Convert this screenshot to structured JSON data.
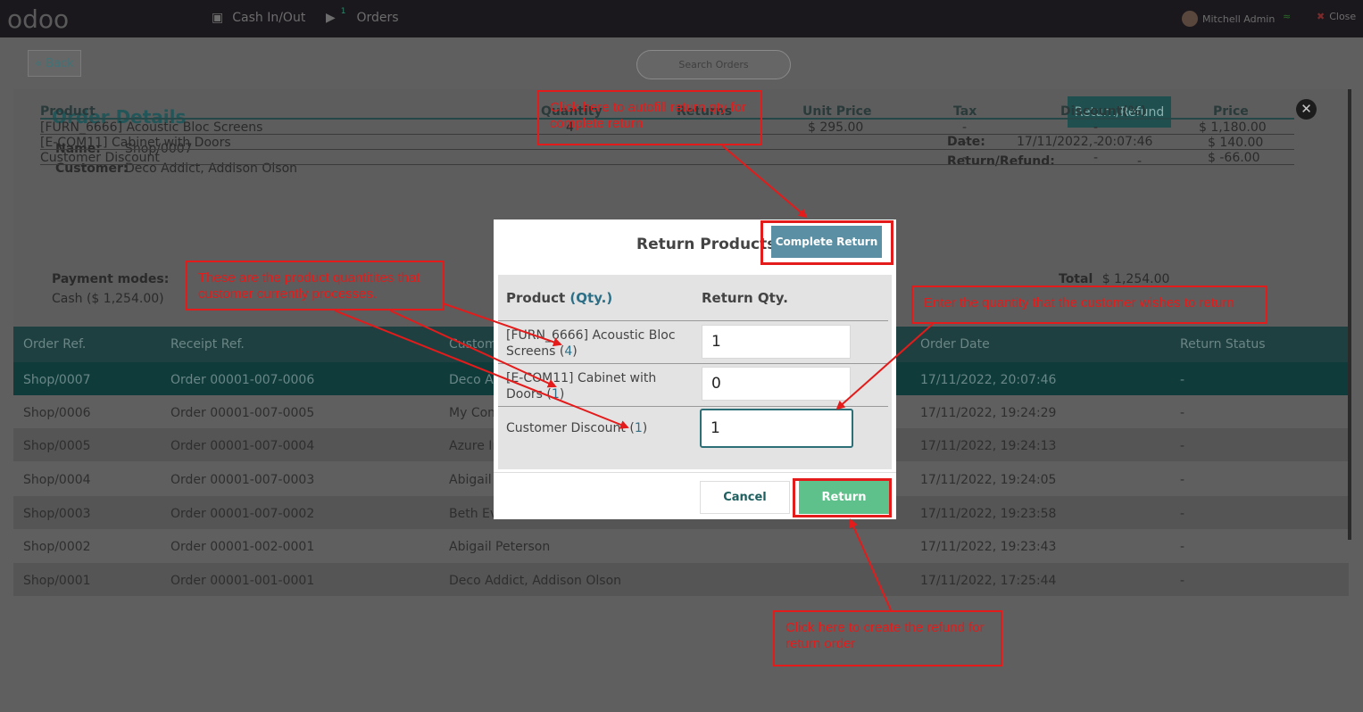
{
  "topbar": {
    "logo": "odoo",
    "cash_label": "Cash In/Out",
    "orders_label": "Orders",
    "orders_badge": "1",
    "user": "Mitchell Admin",
    "close_label": "Close"
  },
  "toolbar": {
    "back_label": "« Back",
    "search_placeholder": "Search Orders"
  },
  "details": {
    "title": "Order Details",
    "name_label": "Name:",
    "name_value": "Shop/0007",
    "customer_label": "Customer:",
    "customer_value": "Deco Addict, Addison Olson",
    "date_label": "Date:",
    "date_value": "17/11/2022, 20:07:46",
    "rr_label": "Return/Refund:",
    "rr_value": "-",
    "rr_button": "Return/Refund",
    "payment_label": "Payment modes:",
    "payment_value": "Cash ($ 1,254.00)",
    "total_label": "Total",
    "total_value": "$ 1,254.00",
    "headers": [
      "Product",
      "Quantity",
      "Returns",
      "Unit Price",
      "Tax",
      "Discount(%)",
      "Price"
    ],
    "rows": [
      {
        "product": "[FURN_6666] Acoustic Bloc Screens",
        "qty": "4",
        "unit": "$ 295.00",
        "tax": "-",
        "disc": "-",
        "price": "$ 1,180.00"
      },
      {
        "product": "[E-COM11] Cabinet with Doors",
        "qty": "",
        "unit": "",
        "tax": "-",
        "disc": "-",
        "price": "$ 140.00"
      },
      {
        "product": "Customer Discount",
        "qty": "",
        "unit": "",
        "tax": "-",
        "disc": "-",
        "price": "$ -66.00"
      }
    ]
  },
  "orders": {
    "headers": [
      "Order Ref.",
      "Receipt Ref.",
      "Custom",
      "Order Date",
      "Return Status"
    ],
    "rows": [
      {
        "ref": "Shop/0007",
        "receipt": "Order 00001-007-0006",
        "customer": "Deco A",
        "date": "17/11/2022, 20:07:46",
        "status": "-"
      },
      {
        "ref": "Shop/0006",
        "receipt": "Order 00001-007-0005",
        "customer": "My Com",
        "date": "17/11/2022, 19:24:29",
        "status": "-"
      },
      {
        "ref": "Shop/0005",
        "receipt": "Order 00001-007-0004",
        "customer": "Azure In",
        "date": "17/11/2022, 19:24:13",
        "status": "-"
      },
      {
        "ref": "Shop/0004",
        "receipt": "Order 00001-007-0003",
        "customer": "Abigail P",
        "date": "17/11/2022, 19:24:05",
        "status": "-"
      },
      {
        "ref": "Shop/0003",
        "receipt": "Order 00001-007-0002",
        "customer": "Beth Ev",
        "date": "17/11/2022, 19:23:58",
        "status": "-"
      },
      {
        "ref": "Shop/0002",
        "receipt": "Order 00001-002-0001",
        "customer": "Abigail Peterson",
        "date": "17/11/2022, 19:23:43",
        "status": "-"
      },
      {
        "ref": "Shop/0001",
        "receipt": "Order 00001-001-0001",
        "customer": "Deco Addict, Addison Olson",
        "date": "17/11/2022, 17:25:44",
        "status": "-"
      }
    ]
  },
  "modal": {
    "title": "Return Products",
    "complete_button": "Complete Return",
    "col_product": "Product",
    "col_qty_label": "Qty.",
    "col_return": "Return Qty.",
    "items": [
      {
        "name": "[FURN_6666] Acoustic Bloc Screens",
        "qty": "4",
        "return_qty": "1"
      },
      {
        "name": "[E-COM11] Cabinet with Doors",
        "qty": "1",
        "return_qty": "0"
      },
      {
        "name": "Customer Discount",
        "qty": "1",
        "return_qty": "1"
      }
    ],
    "cancel_button": "Cancel",
    "return_button": "Return"
  },
  "callouts": {
    "autofill": "Click here to autofill return qty for complete return",
    "quantities": "These are the product quantitites that customer currently processes.",
    "enter_qty": "Enter the quantity that the customer wishes to return",
    "refund": "Click here to create the refund for return order"
  },
  "colors": {
    "annotation": "#e31b1b",
    "return_button": "#5ec08a",
    "complete_button": "#5b8fa3",
    "brand_teal": "#235659"
  }
}
